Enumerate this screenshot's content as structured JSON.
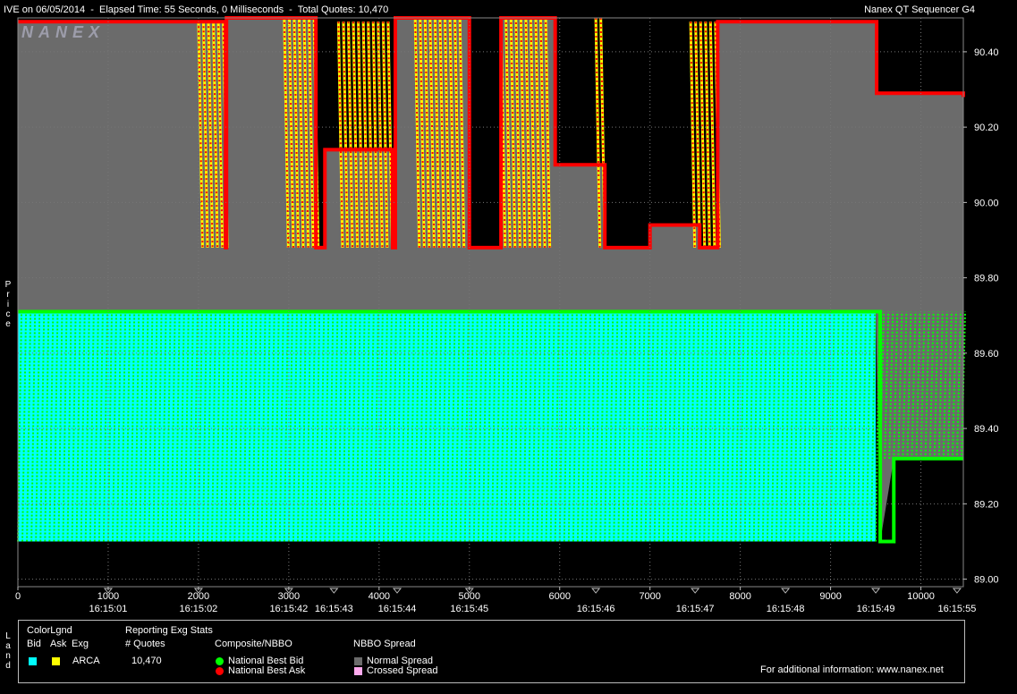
{
  "header": {
    "title_left": "IVE on 06/05/2014  -  Elapsed Time: 55 Seconds, 0 Milliseconds  -  Total Quotes: 10,470",
    "title_right": "Nanex QT Sequencer G4",
    "watermark": "NANEX"
  },
  "side_labels": {
    "price": "P\nr\ni\nc\ne",
    "legend": "L\na\nn\nd"
  },
  "legend": {
    "colorlgnd_title": "ColorLgnd",
    "col_bid": "Bid",
    "col_ask": "Ask",
    "col_exg": "Exg",
    "exg_name": "ARCA",
    "stats_title": "Reporting Exg Stats",
    "stats_col": "# Quotes",
    "stats_value": "10,470",
    "composite_title": "Composite/NBBO",
    "nbb_label": "National Best Bid",
    "nbo_label": "National Best Ask",
    "spread_title": "NBBO Spread",
    "normal_label": "Normal Spread",
    "crossed_label": "Crossed Spread",
    "info": "For additional information: www.nanex.net"
  },
  "colors": {
    "bid_fill": "#00ffff",
    "ask_fill": "#ffff00",
    "nbb": "#00ff00",
    "nbo": "#ff0000",
    "normal_spread": "#6b6b6b",
    "crossed_spread": "#ffaaee"
  },
  "chart_data": {
    "type": "area",
    "x_ticks": [
      0,
      1000,
      2000,
      3000,
      4000,
      5000,
      6000,
      7000,
      8000,
      9000,
      10000
    ],
    "time_labels": [
      {
        "x": 1000,
        "label": "16:15:01"
      },
      {
        "x": 2000,
        "label": "16:15:02"
      },
      {
        "x": 3000,
        "label": "16:15:42"
      },
      {
        "x": 3500,
        "label": "16:15:43"
      },
      {
        "x": 4200,
        "label": "16:15:44"
      },
      {
        "x": 5000,
        "label": "16:15:45"
      },
      {
        "x": 6400,
        "label": "16:15:46"
      },
      {
        "x": 7500,
        "label": "16:15:47"
      },
      {
        "x": 8500,
        "label": "16:15:48"
      },
      {
        "x": 9500,
        "label": "16:15:49"
      },
      {
        "x": 10400,
        "label": "16:15:55"
      }
    ],
    "xlim": [
      0,
      10470
    ],
    "ylim": [
      88.98,
      90.49
    ],
    "y_ticks": [
      89.0,
      89.2,
      89.4,
      89.6,
      89.8,
      90.0,
      90.2,
      90.4
    ],
    "y_tick_labels": [
      "89.00",
      "89.20",
      "89.40",
      "89.60",
      "89.80",
      "90.00",
      "90.20",
      "90.40"
    ],
    "ask_series": [
      {
        "x": 0,
        "y": 90.48
      },
      {
        "x": 2000,
        "y": 90.48
      },
      {
        "x": 2300,
        "y": 89.88
      },
      {
        "x": 2310,
        "y": 90.49
      },
      {
        "x": 2950,
        "y": 90.49
      },
      {
        "x": 3300,
        "y": 89.88
      },
      {
        "x": 3400,
        "y": 90.14
      },
      {
        "x": 3550,
        "y": 90.14
      },
      {
        "x": 4150,
        "y": 89.88
      },
      {
        "x": 4180,
        "y": 90.49
      },
      {
        "x": 4950,
        "y": 90.49
      },
      {
        "x": 5000,
        "y": 89.88
      },
      {
        "x": 5350,
        "y": 90.49
      },
      {
        "x": 5850,
        "y": 90.49
      },
      {
        "x": 5950,
        "y": 90.1
      },
      {
        "x": 6400,
        "y": 90.1
      },
      {
        "x": 6500,
        "y": 89.88
      },
      {
        "x": 7000,
        "y": 89.94
      },
      {
        "x": 7450,
        "y": 89.94
      },
      {
        "x": 7550,
        "y": 89.88
      },
      {
        "x": 7750,
        "y": 90.48
      },
      {
        "x": 9500,
        "y": 90.48
      },
      {
        "x": 9510,
        "y": 90.29
      },
      {
        "x": 10470,
        "y": 90.28
      }
    ],
    "bid_series": [
      {
        "x": 0,
        "y": 89.71
      },
      {
        "x": 9500,
        "y": 89.71
      },
      {
        "x": 9550,
        "y": 89.1
      },
      {
        "x": 9700,
        "y": 89.32
      },
      {
        "x": 10470,
        "y": 89.32
      }
    ],
    "grid": true,
    "legend_position": "bottom"
  }
}
